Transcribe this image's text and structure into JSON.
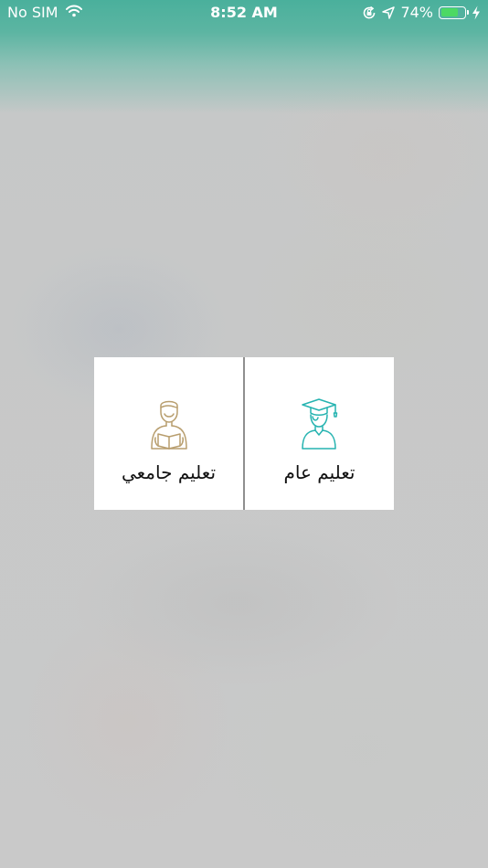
{
  "status_bar": {
    "carrier": "No SIM",
    "time": "8:52 AM",
    "battery_text": "74%",
    "battery_level": 0.74,
    "icons": [
      "wifi-icon",
      "orientation-lock-icon",
      "location-arrow-icon",
      "battery-icon",
      "charging-bolt-icon"
    ]
  },
  "theme": {
    "header_color": "#4ab09c",
    "university_icon_color": "#b89e6e",
    "general_icon_color": "#25b3b0",
    "battery_fill_color": "#4cd964"
  },
  "choices": [
    {
      "key": "university",
      "label": "تعليم جامعي",
      "icon": "student-reading-book-icon"
    },
    {
      "key": "general",
      "label": "تعليم عام",
      "icon": "graduate-cap-icon"
    }
  ]
}
